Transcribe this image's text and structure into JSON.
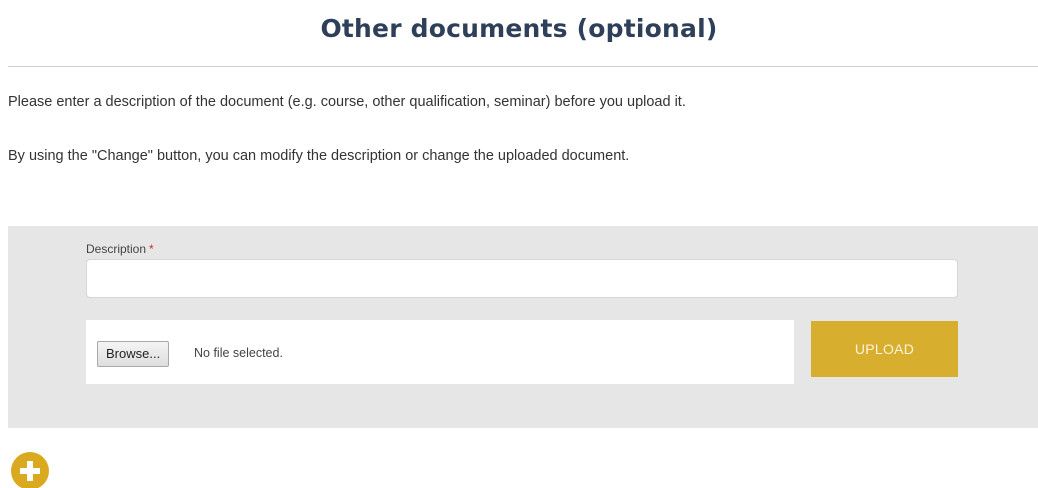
{
  "section": {
    "title": "Other documents (optional)"
  },
  "instructions": {
    "line1": "Please enter a description of the document (e.g. course, other qualification, seminar) before you upload it.",
    "line2": "By using the \"Change\" button, you can modify the description or change the uploaded document."
  },
  "form": {
    "description_label": "Description",
    "required_marker": "*",
    "description_value": "",
    "browse_label": "Browse...",
    "file_status": "No file selected.",
    "upload_label": "UPLOAD"
  },
  "add": {
    "icon": "plus-circle-icon"
  },
  "colors": {
    "title": "#2e3f5a",
    "panel": "#e6e6e6",
    "accent": "#d8ae2e",
    "required": "#d9262c"
  }
}
